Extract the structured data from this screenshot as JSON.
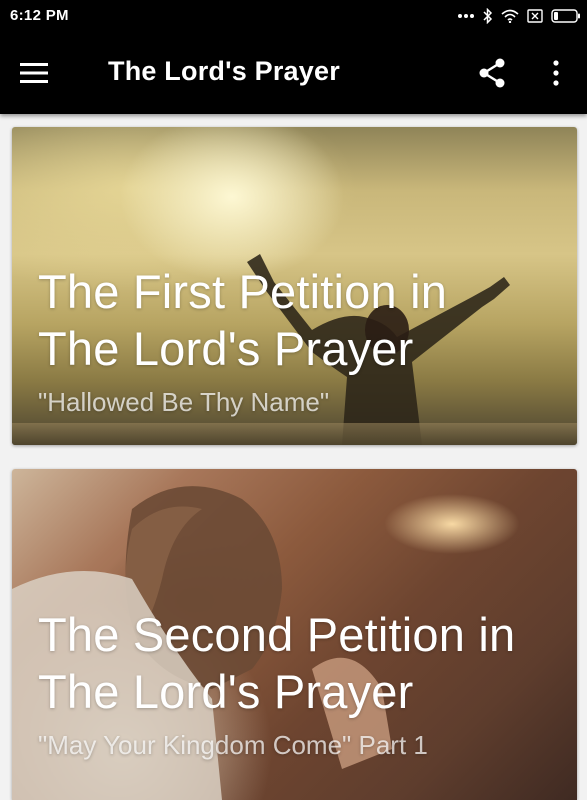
{
  "status_bar": {
    "time": "6:12 PM",
    "icons": [
      "more-dots-icon",
      "bluetooth-icon",
      "wifi-icon",
      "sim-icon",
      "battery-icon"
    ]
  },
  "app_bar": {
    "title": "The Lord's Prayer",
    "icons": [
      "menu-icon",
      "share-icon",
      "more-vertical-icon"
    ]
  },
  "cards": [
    {
      "title_line1": "The First Petition in",
      "title_line2": "The Lord's Prayer",
      "subtitle": "\"Hallowed Be Thy Name\""
    },
    {
      "title_line1": "The Second Petition in",
      "title_line2": "The Lord's Prayer",
      "subtitle": "\"May Your Kingdom Come\" Part 1"
    }
  ],
  "colors": {
    "bar_background": "#000000",
    "page_background": "#f2f2f2",
    "text_on_image": "#ffffff"
  }
}
